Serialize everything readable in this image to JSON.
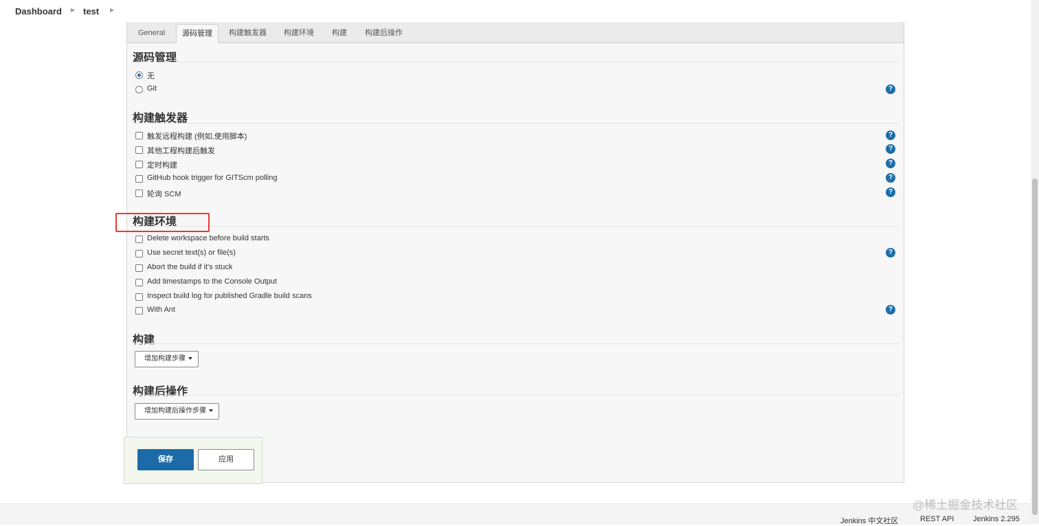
{
  "breadcrumb": {
    "items": [
      "Dashboard",
      "test"
    ]
  },
  "tabs": [
    "General",
    "源码管理",
    "构建触发器",
    "构建环境",
    "构建",
    "构建后操作"
  ],
  "active_tab": "源码管理",
  "scm": {
    "title": "源码管理",
    "options": [
      {
        "label": "无",
        "selected": true
      },
      {
        "label": "Git",
        "selected": false
      }
    ]
  },
  "triggers": {
    "title": "构建触发器",
    "options": [
      "触发远程构建 (例如,使用脚本)",
      "其他工程构建后触发",
      "定时构建",
      "GitHub hook trigger for GITScm polling",
      "轮询 SCM"
    ]
  },
  "environment": {
    "title": "构建环境",
    "options": [
      "Delete workspace before build starts",
      "Use secret text(s) or file(s)",
      "Abort the build if it's stuck",
      "Add timestamps to the Console Output",
      "Inspect build log for published Gradle build scans",
      "With Ant"
    ]
  },
  "build": {
    "title": "构建",
    "add_step_label": "增加构建步骤"
  },
  "post_build": {
    "title": "构建后操作",
    "add_step_label": "增加构建后操作步骤"
  },
  "actions": {
    "save_label": "保存",
    "apply_label": "应用"
  },
  "help_glyph": "?",
  "footer": {
    "community_label": "Jenkins 中文社区",
    "rest_api_label": "REST API",
    "version_label": "Jenkins 2.295"
  },
  "watermark": "@稀土掘金技术社区",
  "colors": {
    "primary": "#1c6aa8",
    "highlight": "#e53935",
    "help": "#1b6ea8"
  }
}
